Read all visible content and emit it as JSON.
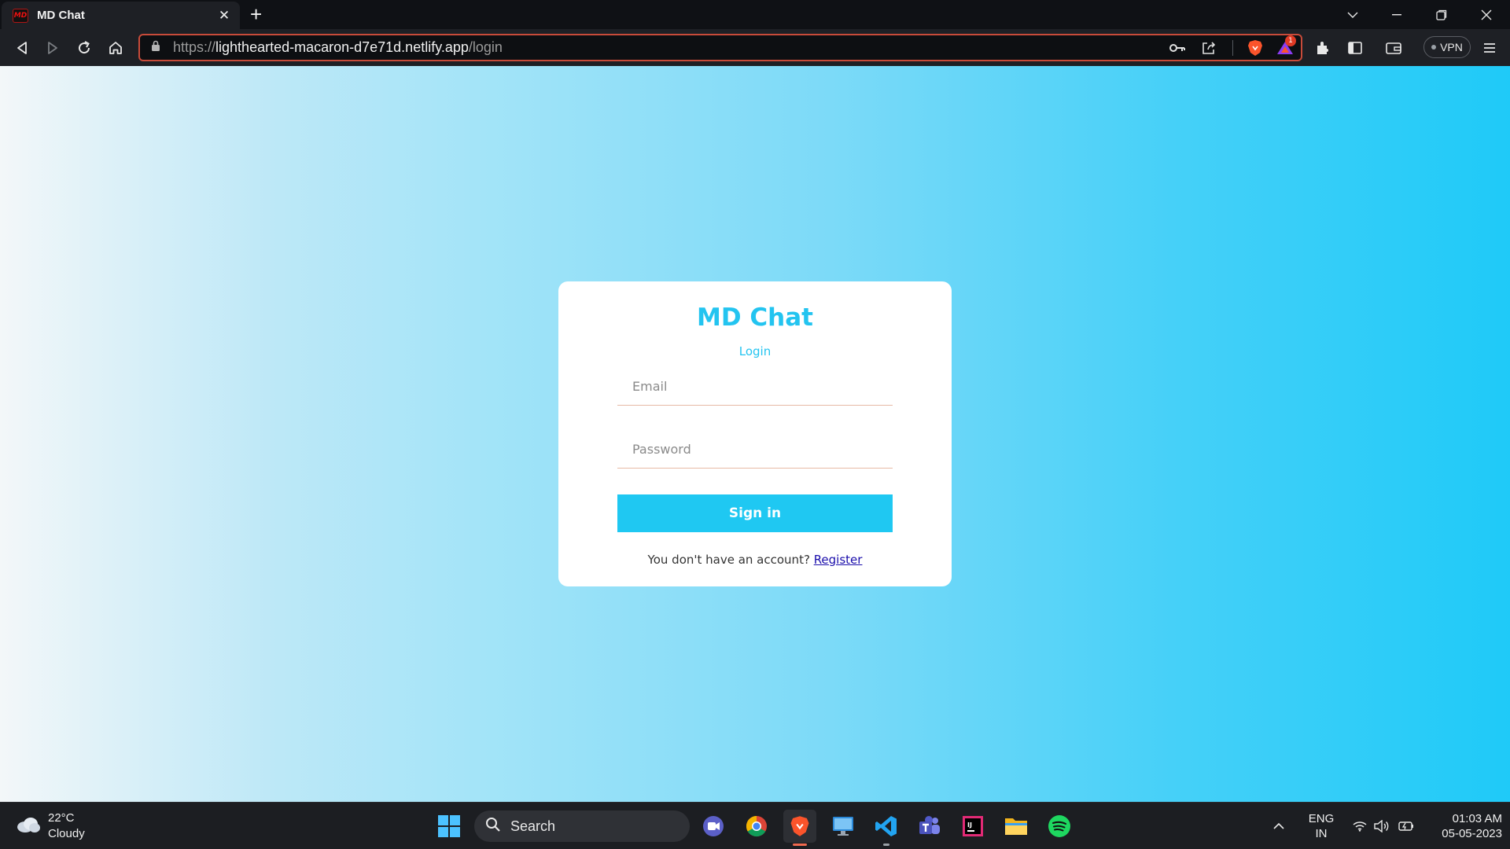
{
  "browser": {
    "tab_title": "MD Chat",
    "favicon_text": "MD",
    "url_scheme": "https://",
    "url_host": "lighthearted-macaron-d7e71d.netlify.app",
    "url_path": "/login",
    "vpn_label": "VPN",
    "notification_count": "1",
    "icons": [
      "back-icon",
      "forward-icon",
      "reload-icon",
      "home-icon",
      "lock-icon",
      "key-icon",
      "share-icon",
      "brave-shield-icon",
      "brave-rewards-icon",
      "extensions-icon",
      "sidebar-icon",
      "wallet-icon",
      "menu-icon"
    ]
  },
  "app": {
    "title": "MD Chat",
    "subtitle": "Login",
    "email_placeholder": "Email",
    "password_placeholder": "Password",
    "signin_label": "Sign in",
    "register_prompt": "You don't have an account? ",
    "register_link": "Register",
    "accent": "#1fc8f2"
  },
  "taskbar": {
    "temperature": "22°C",
    "weather": "Cloudy",
    "search_label": "Search",
    "language": "ENG",
    "region": "IN",
    "time": "01:03 AM",
    "date": "05-05-2023",
    "apps": [
      "windows-start-icon",
      "meet-icon",
      "chrome-icon",
      "brave-icon",
      "remote-desktop-icon",
      "vscode-icon",
      "teams-icon",
      "intellij-icon",
      "file-explorer-icon",
      "spotify-icon"
    ]
  }
}
